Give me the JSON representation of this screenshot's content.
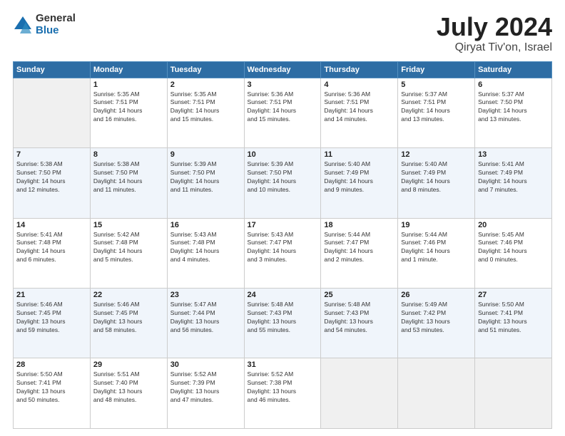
{
  "logo": {
    "general": "General",
    "blue": "Blue"
  },
  "header": {
    "month": "July 2024",
    "location": "Qiryat Tiv'on, Israel"
  },
  "weekdays": [
    "Sunday",
    "Monday",
    "Tuesday",
    "Wednesday",
    "Thursday",
    "Friday",
    "Saturday"
  ],
  "weeks": [
    [
      {
        "day": "",
        "info": ""
      },
      {
        "day": "1",
        "info": "Sunrise: 5:35 AM\nSunset: 7:51 PM\nDaylight: 14 hours\nand 16 minutes."
      },
      {
        "day": "2",
        "info": "Sunrise: 5:35 AM\nSunset: 7:51 PM\nDaylight: 14 hours\nand 15 minutes."
      },
      {
        "day": "3",
        "info": "Sunrise: 5:36 AM\nSunset: 7:51 PM\nDaylight: 14 hours\nand 15 minutes."
      },
      {
        "day": "4",
        "info": "Sunrise: 5:36 AM\nSunset: 7:51 PM\nDaylight: 14 hours\nand 14 minutes."
      },
      {
        "day": "5",
        "info": "Sunrise: 5:37 AM\nSunset: 7:51 PM\nDaylight: 14 hours\nand 13 minutes."
      },
      {
        "day": "6",
        "info": "Sunrise: 5:37 AM\nSunset: 7:50 PM\nDaylight: 14 hours\nand 13 minutes."
      }
    ],
    [
      {
        "day": "7",
        "info": "Sunrise: 5:38 AM\nSunset: 7:50 PM\nDaylight: 14 hours\nand 12 minutes."
      },
      {
        "day": "8",
        "info": "Sunrise: 5:38 AM\nSunset: 7:50 PM\nDaylight: 14 hours\nand 11 minutes."
      },
      {
        "day": "9",
        "info": "Sunrise: 5:39 AM\nSunset: 7:50 PM\nDaylight: 14 hours\nand 11 minutes."
      },
      {
        "day": "10",
        "info": "Sunrise: 5:39 AM\nSunset: 7:50 PM\nDaylight: 14 hours\nand 10 minutes."
      },
      {
        "day": "11",
        "info": "Sunrise: 5:40 AM\nSunset: 7:49 PM\nDaylight: 14 hours\nand 9 minutes."
      },
      {
        "day": "12",
        "info": "Sunrise: 5:40 AM\nSunset: 7:49 PM\nDaylight: 14 hours\nand 8 minutes."
      },
      {
        "day": "13",
        "info": "Sunrise: 5:41 AM\nSunset: 7:49 PM\nDaylight: 14 hours\nand 7 minutes."
      }
    ],
    [
      {
        "day": "14",
        "info": "Sunrise: 5:41 AM\nSunset: 7:48 PM\nDaylight: 14 hours\nand 6 minutes."
      },
      {
        "day": "15",
        "info": "Sunrise: 5:42 AM\nSunset: 7:48 PM\nDaylight: 14 hours\nand 5 minutes."
      },
      {
        "day": "16",
        "info": "Sunrise: 5:43 AM\nSunset: 7:48 PM\nDaylight: 14 hours\nand 4 minutes."
      },
      {
        "day": "17",
        "info": "Sunrise: 5:43 AM\nSunset: 7:47 PM\nDaylight: 14 hours\nand 3 minutes."
      },
      {
        "day": "18",
        "info": "Sunrise: 5:44 AM\nSunset: 7:47 PM\nDaylight: 14 hours\nand 2 minutes."
      },
      {
        "day": "19",
        "info": "Sunrise: 5:44 AM\nSunset: 7:46 PM\nDaylight: 14 hours\nand 1 minute."
      },
      {
        "day": "20",
        "info": "Sunrise: 5:45 AM\nSunset: 7:46 PM\nDaylight: 14 hours\nand 0 minutes."
      }
    ],
    [
      {
        "day": "21",
        "info": "Sunrise: 5:46 AM\nSunset: 7:45 PM\nDaylight: 13 hours\nand 59 minutes."
      },
      {
        "day": "22",
        "info": "Sunrise: 5:46 AM\nSunset: 7:45 PM\nDaylight: 13 hours\nand 58 minutes."
      },
      {
        "day": "23",
        "info": "Sunrise: 5:47 AM\nSunset: 7:44 PM\nDaylight: 13 hours\nand 56 minutes."
      },
      {
        "day": "24",
        "info": "Sunrise: 5:48 AM\nSunset: 7:43 PM\nDaylight: 13 hours\nand 55 minutes."
      },
      {
        "day": "25",
        "info": "Sunrise: 5:48 AM\nSunset: 7:43 PM\nDaylight: 13 hours\nand 54 minutes."
      },
      {
        "day": "26",
        "info": "Sunrise: 5:49 AM\nSunset: 7:42 PM\nDaylight: 13 hours\nand 53 minutes."
      },
      {
        "day": "27",
        "info": "Sunrise: 5:50 AM\nSunset: 7:41 PM\nDaylight: 13 hours\nand 51 minutes."
      }
    ],
    [
      {
        "day": "28",
        "info": "Sunrise: 5:50 AM\nSunset: 7:41 PM\nDaylight: 13 hours\nand 50 minutes."
      },
      {
        "day": "29",
        "info": "Sunrise: 5:51 AM\nSunset: 7:40 PM\nDaylight: 13 hours\nand 48 minutes."
      },
      {
        "day": "30",
        "info": "Sunrise: 5:52 AM\nSunset: 7:39 PM\nDaylight: 13 hours\nand 47 minutes."
      },
      {
        "day": "31",
        "info": "Sunrise: 5:52 AM\nSunset: 7:38 PM\nDaylight: 13 hours\nand 46 minutes."
      },
      {
        "day": "",
        "info": ""
      },
      {
        "day": "",
        "info": ""
      },
      {
        "day": "",
        "info": ""
      }
    ]
  ]
}
